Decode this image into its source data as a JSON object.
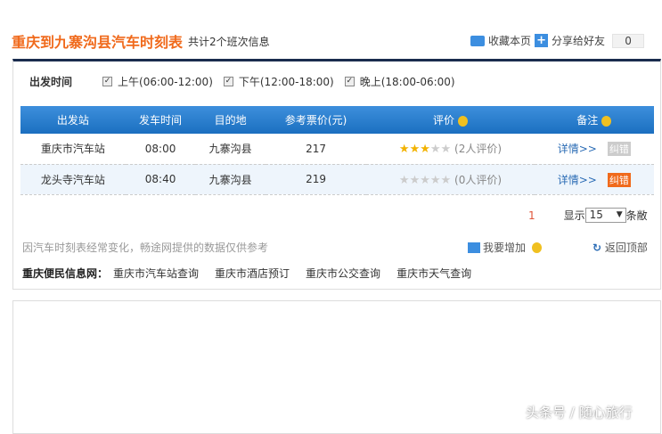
{
  "header": {
    "title": "重庆到九寨沟县汽车时刻表",
    "count": "共计2个班次信息",
    "bookmark": "收藏本页",
    "share": "分享给好友",
    "share_count": "0"
  },
  "filter": {
    "label": "出发时间",
    "options": [
      "上午(06:00-12:00)",
      "下午(12:00-18:00)",
      "晚上(18:00-06:00)"
    ]
  },
  "table": {
    "headers": [
      "出发站",
      "发车时间",
      "目的地",
      "参考票价(元)",
      "评价",
      "备注"
    ],
    "rows": [
      {
        "station": "重庆市汽车站",
        "time": "08:00",
        "dest": "九寨沟县",
        "price": "217",
        "stars": 3,
        "reviews": "(2人评价)",
        "detail": "详情>>",
        "report": "纠错"
      },
      {
        "station": "龙头寺汽车站",
        "time": "08:40",
        "dest": "九寨沟县",
        "price": "219",
        "stars": 0,
        "reviews": "(0人评价)",
        "detail": "详情>>",
        "report": "纠错"
      }
    ]
  },
  "pager": {
    "page": "1",
    "show": "显示",
    "per_page": "15",
    "unit": "条敝"
  },
  "footer": {
    "note": "因汽车时刻表经常变化，畅途网提供的数据仅供参考",
    "add": "我要增加",
    "back_top": "返回顶部",
    "links_label": "重庆便民信息网：",
    "links": [
      "重庆市汽车站查询",
      "重庆市酒店预订",
      "重庆市公交查询",
      "重庆市天气查询"
    ]
  },
  "watermark": "头条号 / 随心旅行"
}
